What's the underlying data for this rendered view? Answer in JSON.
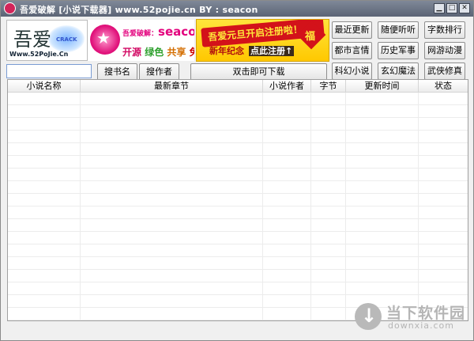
{
  "window": {
    "title": "吾爱破解 [小说下载器]  www.52pojie.cn BY : seacon",
    "controls": {
      "minimize": "▁",
      "maximize": "□",
      "close": "✕"
    }
  },
  "logos": {
    "site_logo": {
      "big_text": "吾爱",
      "sub_text": "Www.52PoJie.Cn",
      "crack_text": "CRACK"
    },
    "seacon_logo": {
      "prefix": "吾爱破解：",
      "name": "seacon",
      "tags": [
        "开源",
        "绿色",
        "共享",
        "免费"
      ]
    },
    "banner": {
      "line1": "吾爱元旦开启注册啦！",
      "line2": "新年纪念",
      "goto": "点此注册↑",
      "badge": "福"
    }
  },
  "categories": [
    [
      "最近更新",
      "随便听听",
      "字数排行"
    ],
    [
      "都市言情",
      "历史军事",
      "网游动漫"
    ],
    [
      "科幻小说",
      "玄幻魔法",
      "武侠修真"
    ]
  ],
  "search": {
    "input_value": "",
    "by_title_label": "搜书名",
    "by_author_label": "搜作者",
    "download_label": "双击即可下载"
  },
  "table": {
    "columns": [
      "小说名称",
      "最新章节",
      "小说作者",
      "字节",
      "更新时间",
      "状态"
    ],
    "rows": []
  },
  "watermark": {
    "name": "当下软件园",
    "url": "downxia.com",
    "icon": "download-arrow-icon"
  },
  "colors": {
    "titlebar": "#6b7384",
    "accent_pink": "#e3007d",
    "banner_yellow": "#ffd21a",
    "banner_red": "#d3121a"
  }
}
